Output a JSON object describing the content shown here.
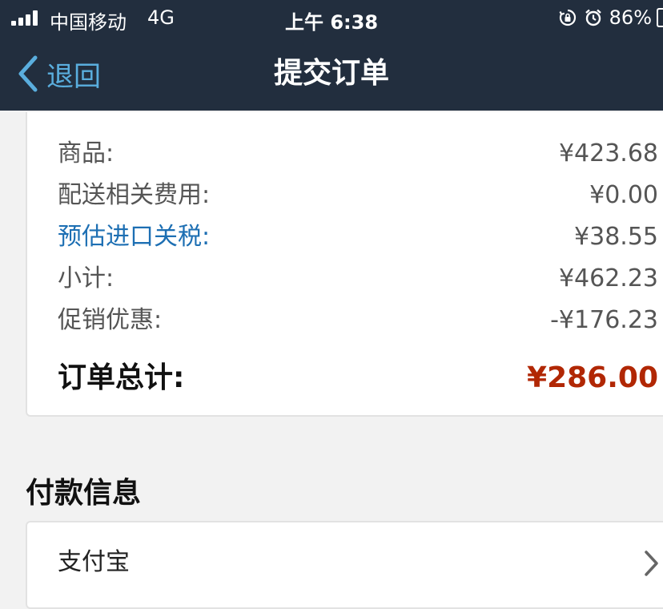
{
  "status_bar": {
    "carrier": "中国移动",
    "network": "4G",
    "time": "上午 6:38",
    "battery": "86%",
    "icons": [
      "signal-icon",
      "rotation-lock-icon",
      "alarm-icon",
      "battery-icon"
    ]
  },
  "nav": {
    "back_label": "退回",
    "title": "提交订单",
    "icons": [
      "chevron-left-icon"
    ]
  },
  "summary": {
    "rows": [
      {
        "label": "商品:",
        "value": "¥423.68"
      },
      {
        "label": "配送相关费用:",
        "value": "¥0.00"
      },
      {
        "label": "预估进口关税:",
        "value": "¥38.55"
      },
      {
        "label": "小计:",
        "value": "¥462.23"
      },
      {
        "label": "促销优惠:",
        "value": "-¥176.23"
      }
    ],
    "total": {
      "label": "订单总计:",
      "value": "¥286.00"
    }
  },
  "payment": {
    "title": "付款信息",
    "method": "支付宝",
    "icons": [
      "chevron-right-icon"
    ]
  },
  "colors": {
    "header_bg": "#222e3e",
    "back_accent": "#5aaede",
    "link_blue": "#1d6fb3",
    "total_red": "#b12704",
    "page_bg": "#f2f2f2"
  }
}
